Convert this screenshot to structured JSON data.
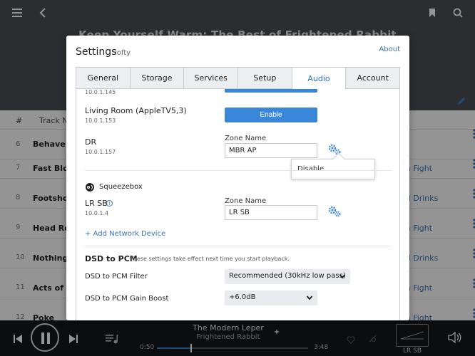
{
  "app": {
    "album_title": "Keep Yourself Warm: The Best of Frightened Rabbit",
    "list_headers": {
      "num": "#",
      "track": "Track Na"
    },
    "rows": [
      {
        "num": "6",
        "name": "Behave!",
        "right": ""
      },
      {
        "num": "7",
        "name": "Fast Blood",
        "right": "an Fight"
      },
      {
        "num": "8",
        "name": "Footshoot",
        "right": "ed Drinks"
      },
      {
        "num": "9",
        "name": "Head Rolls",
        "right": "an Fight"
      },
      {
        "num": "10",
        "name": "Nothing L",
        "right": "ed Drinks"
      },
      {
        "num": "11",
        "name": "Acts of Ma",
        "right": "an Fight"
      },
      {
        "num": "12",
        "name": "Poke",
        "right": "an Fight"
      }
    ]
  },
  "player": {
    "track": "The Modern Leper",
    "artist": "Frightened Rabbit",
    "time_elapsed": "0:50",
    "time_total": "3:48",
    "progress": 0.22,
    "zone_label": "LR SB"
  },
  "settings": {
    "title": "Settings",
    "subtitle": "lofty",
    "about": "About",
    "tabs": [
      "General",
      "Storage",
      "Services",
      "Setup",
      "Audio",
      "Account"
    ],
    "active_tab": "Audio",
    "devices": [
      {
        "name": "",
        "ip": "10.0.1.145"
      },
      {
        "name": "Living Room (AppleTV5,3)",
        "ip": "10.0.1.153",
        "button": "Enable"
      },
      {
        "name": "DR",
        "ip": "10.0.1.157",
        "zone_label": "Zone Name",
        "zone_value": "MBR AP"
      },
      {
        "name": "LR SB",
        "ip": "10.0.1.4",
        "zone_label": "Zone Name",
        "zone_value": "LR SB"
      }
    ],
    "popup_option": "Disable",
    "squeezebox_label": "Squeezebox",
    "add_device": "+ Add Network Device",
    "dsd": {
      "title": "DSD to PCM",
      "note": "These settings take effect next time you start playback.",
      "filter_label": "DSD to PCM Filter",
      "filter_value": "Recommended (30kHz low pass)",
      "gain_label": "DSD to PCM Gain Boost",
      "gain_value": "+6.0dB"
    }
  },
  "colors": {
    "accent": "#3a86d9",
    "link": "#3a73b8"
  }
}
